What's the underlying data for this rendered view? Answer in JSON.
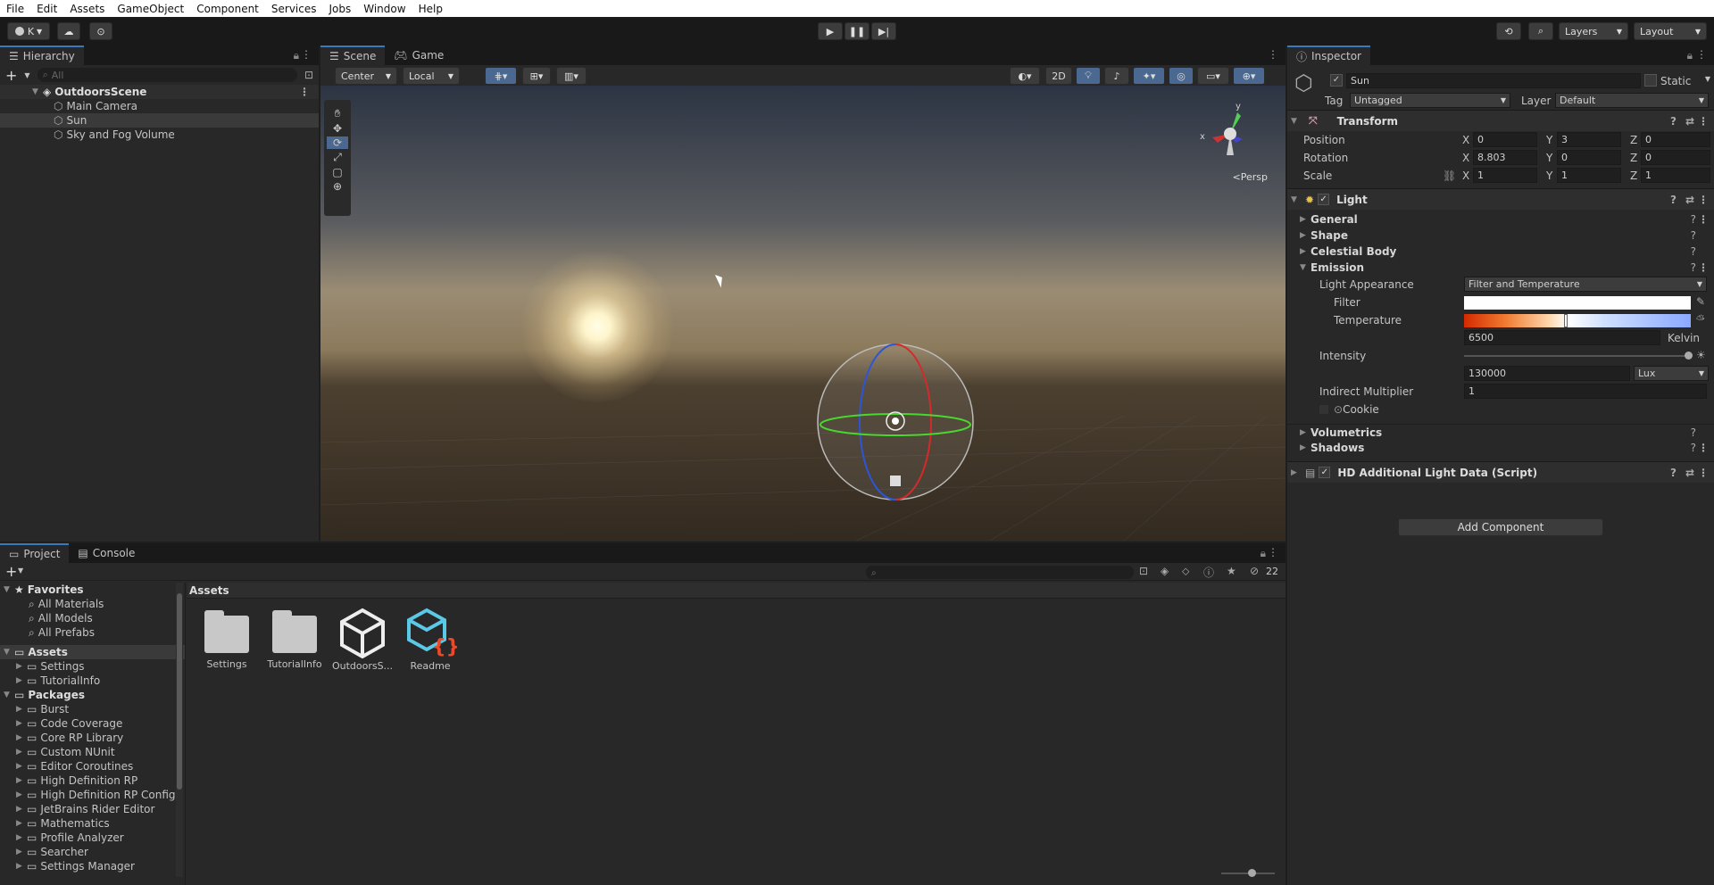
{
  "menu": [
    "File",
    "Edit",
    "Assets",
    "GameObject",
    "Component",
    "Services",
    "Jobs",
    "Window",
    "Help"
  ],
  "toolbar": {
    "account": "K",
    "layers": "Layers",
    "layout": "Layout"
  },
  "hierarchy": {
    "tab": "Hierarchy",
    "search_placeholder": "All",
    "scene": "OutdoorsScene",
    "items": [
      "Main Camera",
      "Sun",
      "Sky and Fog Volume"
    ]
  },
  "scene_view": {
    "tabs": [
      "Scene",
      "Game"
    ],
    "pivot": "Center",
    "space": "Local",
    "mode_2d": "2D",
    "persp": "Persp"
  },
  "inspector": {
    "tab": "Inspector",
    "object_name": "Sun",
    "static_label": "Static",
    "tag_label": "Tag",
    "tag_value": "Untagged",
    "layer_label": "Layer",
    "layer_value": "Default",
    "transform": {
      "title": "Transform",
      "position": {
        "label": "Position",
        "x": "0",
        "y": "3",
        "z": "0"
      },
      "rotation": {
        "label": "Rotation",
        "x": "8.803",
        "y": "0",
        "z": "0"
      },
      "scale": {
        "label": "Scale",
        "x": "1",
        "y": "1",
        "z": "1"
      }
    },
    "light": {
      "title": "Light",
      "sections": [
        "General",
        "Shape",
        "Celestial Body",
        "Emission"
      ],
      "light_appearance_label": "Light Appearance",
      "light_appearance_value": "Filter and Temperature",
      "filter_label": "Filter",
      "temperature_label": "Temperature",
      "temperature_value": "6500",
      "temperature_unit": "Kelvin",
      "intensity_label": "Intensity",
      "intensity_value": "130000",
      "intensity_unit": "Lux",
      "indirect_label": "Indirect Multiplier",
      "indirect_value": "1",
      "cookie_label": "Cookie",
      "more_sections": [
        "Volumetrics",
        "Shadows"
      ]
    },
    "hd_data_title": "HD Additional Light Data (Script)",
    "add_component": "Add Component"
  },
  "project": {
    "tabs": [
      "Project",
      "Console"
    ],
    "hidden_count": "22",
    "favorites_title": "Favorites",
    "favorites": [
      "All Materials",
      "All Models",
      "All Prefabs"
    ],
    "assets_title": "Assets",
    "assets_tree": [
      "Settings",
      "TutorialInfo"
    ],
    "packages_title": "Packages",
    "packages": [
      "Burst",
      "Code Coverage",
      "Core RP Library",
      "Custom NUnit",
      "Editor Coroutines",
      "High Definition RP",
      "High Definition RP Config",
      "JetBrains Rider Editor",
      "Mathematics",
      "Profile Analyzer",
      "Searcher",
      "Settings Manager"
    ],
    "breadcrumb": "Assets",
    "grid": [
      "Settings",
      "TutorialInfo",
      "OutdoorsS...",
      "Readme"
    ]
  },
  "colors": {
    "accent": "#3a79bb",
    "menubar_bg": "#ffffff",
    "panel_bg": "#282828"
  }
}
